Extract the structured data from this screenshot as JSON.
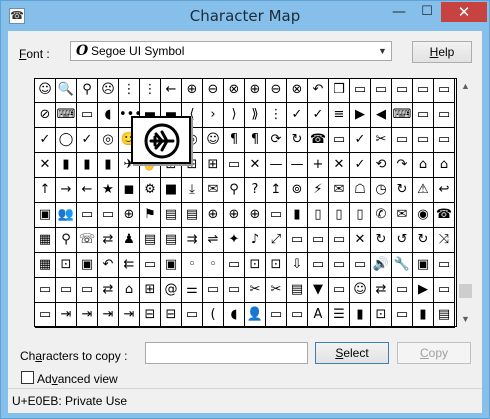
{
  "window": {
    "title": "Character Map",
    "minimize_glyph": "—",
    "maximize_glyph": "☐",
    "close_glyph": "✕"
  },
  "font": {
    "label_prefix": "F",
    "label_rest": "ont :",
    "icon_glyph": "O",
    "selected_value": "Segoe UI Symbol",
    "dropdown_glyph": "▼",
    "help_prefix": "H",
    "help_rest": "elp"
  },
  "grid": {
    "rows": [
      [
        "☺",
        "🔍",
        "⚲",
        "☹",
        "⋮",
        "⋮",
        "←",
        "⊕",
        "⊖",
        "⊗",
        "⊕",
        "⊖",
        "⊗",
        "↶",
        "❒",
        "▭",
        "▭",
        "▭",
        "▭",
        "▭"
      ],
      [
        "⊘",
        "⌨",
        "▭",
        "◖",
        "•••",
        "▬",
        "▬",
        "⟨",
        "›",
        "⟩",
        "⟫",
        "⋮",
        "✓",
        "✓",
        "≡",
        "▶",
        "◀",
        "⌨",
        "▭",
        "▭"
      ],
      [
        "✓",
        "◯",
        "✓",
        "◎",
        "🙂",
        "✈",
        "☺",
        "◎",
        "☺",
        "¶",
        "¶",
        "⟳",
        "↻",
        "☎",
        "▭",
        "✓",
        "✂",
        "▭",
        "▭",
        "▭"
      ],
      [
        "✕",
        "▮",
        "▮",
        "▮",
        "✈",
        "✋",
        "⊞",
        "⊞",
        "⊞",
        "▭",
        "✕",
        "—",
        "—",
        "+",
        "✕",
        "✓",
        "⟲",
        "↷",
        "⌂",
        "⌂"
      ],
      [
        "↑",
        "→",
        "←",
        "★",
        "◼",
        "⚙",
        "■",
        "⤓",
        "✉",
        "⚲",
        "?",
        "↥",
        "⊚",
        "⚡",
        "✉",
        "☖",
        "◷",
        "↻",
        "⚠",
        "↩"
      ],
      [
        "▣",
        "👥",
        "▭",
        "▭",
        "⊕",
        "⚑",
        "▤",
        "▤",
        "⊕",
        "⊕",
        "⊕",
        "▭",
        "▮",
        "▯",
        "▯",
        "▯",
        "✆",
        "✉",
        "◉",
        "☎"
      ],
      [
        "▦",
        "⚲",
        "☏",
        "⇄",
        "♟",
        "▤",
        "▤",
        "⇉",
        "⇌",
        "✦",
        "♪",
        "⤢",
        "▭",
        "▭",
        "▭",
        "✕",
        "↻",
        "↺",
        "↻",
        "⤨"
      ],
      [
        "▦",
        "⊡",
        "▣",
        "↶",
        "⇇",
        "▭",
        "▣",
        "◦",
        "◦",
        "▭",
        "⊡",
        "⊡",
        "⇩",
        "▭",
        "▭",
        "▭",
        "🔊",
        "🔧",
        "▣",
        "▭"
      ],
      [
        "▭",
        "▭",
        "▭",
        "⇄",
        "⌂",
        "⊞",
        "@",
        "⚌",
        "▭",
        "▭",
        "✂",
        "✂",
        "▤",
        "▼",
        "▭",
        "☺",
        "⇄",
        "▭",
        "▶",
        "▭"
      ],
      [
        "▭",
        "⇥",
        "⇥",
        "⇥",
        "⇥",
        "⊟",
        "⊟",
        "▭",
        "(",
        "◖",
        "👤",
        "▭",
        "▭",
        "A",
        "☰",
        "▮",
        "⊡",
        "▭",
        "▮",
        "▤"
      ]
    ]
  },
  "scrollbar": {
    "up_glyph": "▲",
    "down_glyph": "▼"
  },
  "copy": {
    "label_prefix": "Ch",
    "label_accel": "a",
    "label_rest": "racters to copy :",
    "input_value": "",
    "select_prefix": "",
    "select_accel": "S",
    "select_rest": "elect",
    "copy_prefix": "",
    "copy_accel": "C",
    "copy_rest": "opy"
  },
  "advanced": {
    "label_prefix": "Ad",
    "label_accel": "v",
    "label_rest": "anced view",
    "checked": false
  },
  "status": {
    "text": "U+E0EB: Private Use"
  },
  "zoom": {
    "icon": "airplane-icon"
  }
}
